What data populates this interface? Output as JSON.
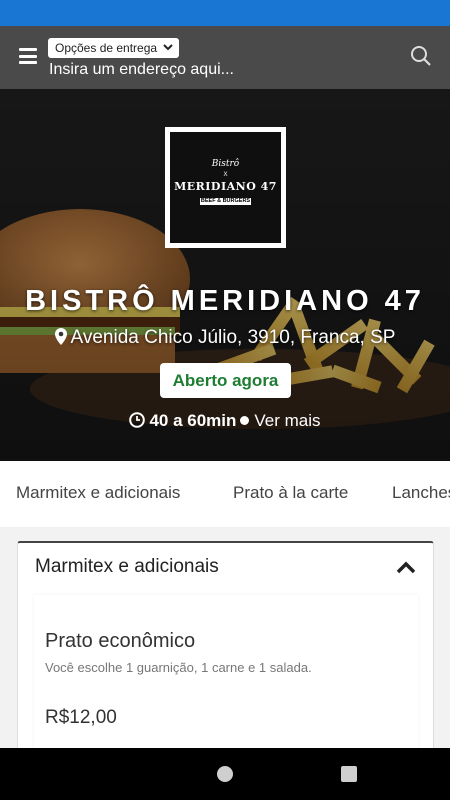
{
  "header": {
    "delivery_options_label": "Opções de entrega",
    "address_placeholder": "Insira um endereço aqui..."
  },
  "store": {
    "logo": {
      "script_text": "Bistrô",
      "x_text": "X",
      "name_text": "MERIDIANO 47",
      "sub_text": "BEEF & BURGERS"
    },
    "name": "BISTRÔ MERIDIANO 47",
    "address": "Avenida Chico Júlio, 3910, Franca, SP",
    "status": "Aberto agora",
    "delivery_time": "40 a 60min",
    "see_more": "Ver mais"
  },
  "tabs": [
    {
      "label": "Marmitex e adicionais"
    },
    {
      "label": "Prato à la carte"
    },
    {
      "label": "Lanches"
    }
  ],
  "section": {
    "title": "Marmitex e adicionais",
    "items": [
      {
        "name": "Prato econômico",
        "description": "Você escolhe 1 guarnição, 1 carne e 1 salada.",
        "price": "R$12,00"
      }
    ]
  },
  "colors": {
    "status_bar": "#1976d2",
    "topbar": "#4a4a4a",
    "open_green": "#1e7d32"
  },
  "icons": [
    "menu-icon",
    "chevron-down-icon",
    "search-icon",
    "map-pin-icon",
    "clock-icon",
    "chevron-up-icon"
  ]
}
